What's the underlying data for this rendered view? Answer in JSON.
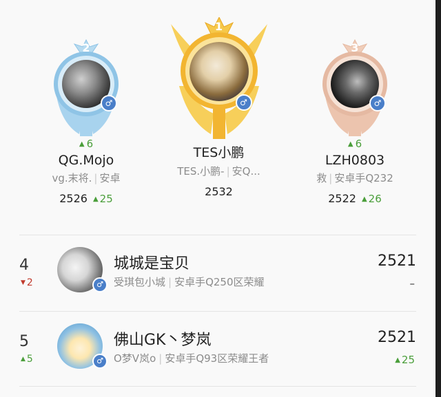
{
  "podium": [
    {
      "rank": "2",
      "delta": "6",
      "name": "QG.Mojo",
      "sub_a": "vg.末将.",
      "sub_b": "安卓",
      "score": "2526",
      "score_change": "25",
      "gender": "♂"
    },
    {
      "rank": "1",
      "delta": "",
      "name": "TES小鹏",
      "sub_a": "TES.小鹏-",
      "sub_b": "安Q...",
      "score": "2532",
      "score_change": "",
      "gender": "♂"
    },
    {
      "rank": "3",
      "delta": "6",
      "name": "LZH0803",
      "sub_a": "救",
      "sub_b": "安卓手Q232",
      "score": "2522",
      "score_change": "26",
      "gender": "♂"
    }
  ],
  "rows": [
    {
      "rank": "4",
      "rank_change": "2",
      "rank_dir": "down",
      "name": "城城是宝贝",
      "sub_a": "受琪包小城",
      "sub_b": "安卓手Q250区荣耀",
      "score": "2521",
      "score_change": "–",
      "gender": "♂"
    },
    {
      "rank": "5",
      "rank_change": "5",
      "rank_dir": "up",
      "name": "佛山GK丶梦岚",
      "sub_a": "O梦V岚o",
      "sub_b": "安卓手Q93区荣耀王者",
      "score": "2521",
      "score_change": "25",
      "gender": "♂"
    }
  ],
  "colors": {
    "up": "#4a9e3a",
    "down": "#c0392b",
    "gold": "#f2b531",
    "silver": "#8fc4e6",
    "bronze": "#e5b9a2",
    "gender_badge": "#4a7fc9"
  },
  "icons": {
    "up_arrow": "▲",
    "down_arrow": "▼",
    "gender": "male-icon"
  }
}
